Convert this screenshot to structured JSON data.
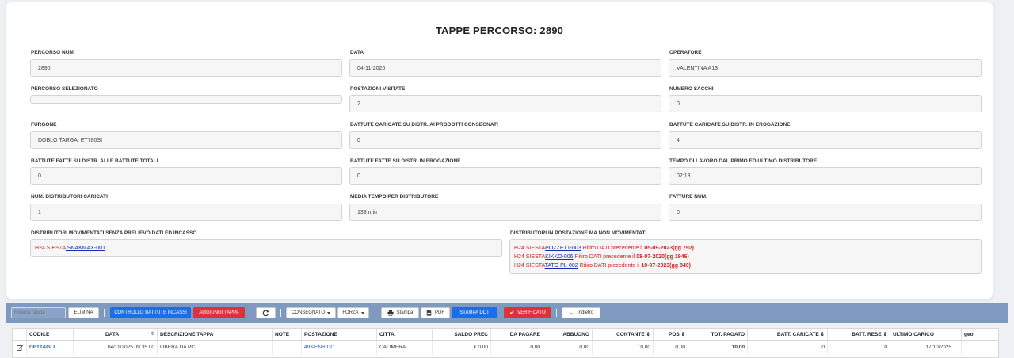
{
  "page": {
    "title": "TAPPE PERCORSO: 2890"
  },
  "fields": {
    "percorso_num": {
      "label": "PERCORSO NUM.",
      "value": "2890"
    },
    "data": {
      "label": "DATA",
      "value": "04-11-2025"
    },
    "operatore": {
      "label": "OPERATORE",
      "value": "VALENTINA A13"
    },
    "percorso_selezionato": {
      "label": "PERCORSO SELEZIONATO",
      "value": ""
    },
    "postazioni_visitate": {
      "label": "POSTAZIONI VISITATE",
      "value": "2"
    },
    "numero_sacchi": {
      "label": "NUMERO SACCHI",
      "value": "0"
    },
    "furgone": {
      "label": "FURGONE",
      "value": "DOBLO TARGA: ET780SI"
    },
    "battute_prodotti": {
      "label": "BATTUTE CARICATE SU DISTR. AI PRODOTTI CONSEGNATI",
      "value": "0"
    },
    "battute_erogazione": {
      "label": "BATTUTE CARICATE SU DISTR. IN EROGAZIONE",
      "value": "4"
    },
    "battute_totali": {
      "label": "BATTUTE FATTE SU DISTR. ALLE BATTUTE TOTALI",
      "value": "0"
    },
    "battute_fatte_erogazione": {
      "label": "BATTUTE FATTE SU DISTR. IN EROGAZIONE",
      "value": "0"
    },
    "tempo_lavoro": {
      "label": "TEMPO DI LAVORO DAL PRIMO ED ULTIMO DISTRIBUTORE",
      "value": "02:13"
    },
    "num_distributori": {
      "label": "NUM. DISTRIBUTORI CARICATI",
      "value": "1"
    },
    "media_tempo": {
      "label": "MEDIA TEMPO PER DISTRIBUTORE",
      "value": "133 min"
    },
    "fatture_num": {
      "label": "FATTURE NUM.",
      "value": "0"
    }
  },
  "senza_prelievo": {
    "label": "DISTRIBUTORI MOVIMENTATI SENZA PRELIEVO DATI ED INCASSO",
    "items": [
      {
        "prefix": "H24 SIESTA",
        "code": " SNAKMAX-001"
      }
    ]
  },
  "non_movimentati": {
    "label": "DISTRIBUTORI IN POSTAZIONE MA NON MOVIMENTATI",
    "items": [
      {
        "prefix": "H24 SIESTA",
        "code": "POZZETT-003",
        "text": " Ritiro DATI precedente il ",
        "date": "05-09-2023",
        "days": "(gg 792)"
      },
      {
        "prefix": "H24 SIESTA",
        "code": "KIKKO-006",
        "text": " Ritiro DATI precedente il ",
        "date": "08-07-2020",
        "days": "(gg 1946)"
      },
      {
        "prefix": "H24 SIESTA",
        "code": "TATO PL-002",
        "text": " Ritiro DATI precedente il ",
        "date": "10-07-2023",
        "days": "(gg 849)"
      }
    ]
  },
  "toolbar": {
    "search_placeholder": "Ricerca rapida",
    "elimina": "ELIMINA",
    "controllo": "CONTROLLO BATTUTE INCASSI",
    "aggiungi": "AGGIUNGI TAPPA",
    "refresh_icon": "refresh-icon",
    "consegnato": "CONSEGNATO",
    "forza": "FORZA",
    "stampa": "Stampa",
    "pdf": "PDF",
    "stampa_ddt": "STAMPA DDT",
    "verificato": "VERIFICATO",
    "indietro": "Indietro",
    "colors": {
      "bar": "#7f9ac1",
      "primary": "#1a6ee6",
      "danger": "#e0303a"
    }
  },
  "table": {
    "headers": {
      "codice": "CODICE",
      "data": "DATA",
      "descrizione": "DESCRIZIONE TAPPA",
      "note": "NOTE",
      "postazione": "POSTAZIONE",
      "citta": "CITTA",
      "saldo": "SALDO PREC",
      "da_pagare": "DA PAGARE",
      "abbuono": "ABBUONO",
      "contante": "CONTANTE",
      "pos": "POS",
      "tot_pagato": "TOT. PAGATO",
      "batt_caricate": "BATT. CARICATE",
      "batt_rese": "BATT. RESE",
      "ultimo_carico": "ULTIMO CARICO",
      "geo": "geo"
    },
    "rows": [
      {
        "codice": "DETTAGLI",
        "data": "04/11/2025 09.35.00",
        "descrizione": "LIBERA DA PC",
        "note": "",
        "postazione": "493-ENRICO",
        "citta": "CALIMERA",
        "saldo": "€ 0,00",
        "da_pagare": "0,00",
        "abbuono": "0,00",
        "contante": "10,00",
        "pos": "0,00",
        "tot_pagato": "10,00",
        "batt_caricate": "0",
        "batt_rese": "0",
        "ultimo_carico": "17/10/2025",
        "geo": ""
      }
    ]
  }
}
